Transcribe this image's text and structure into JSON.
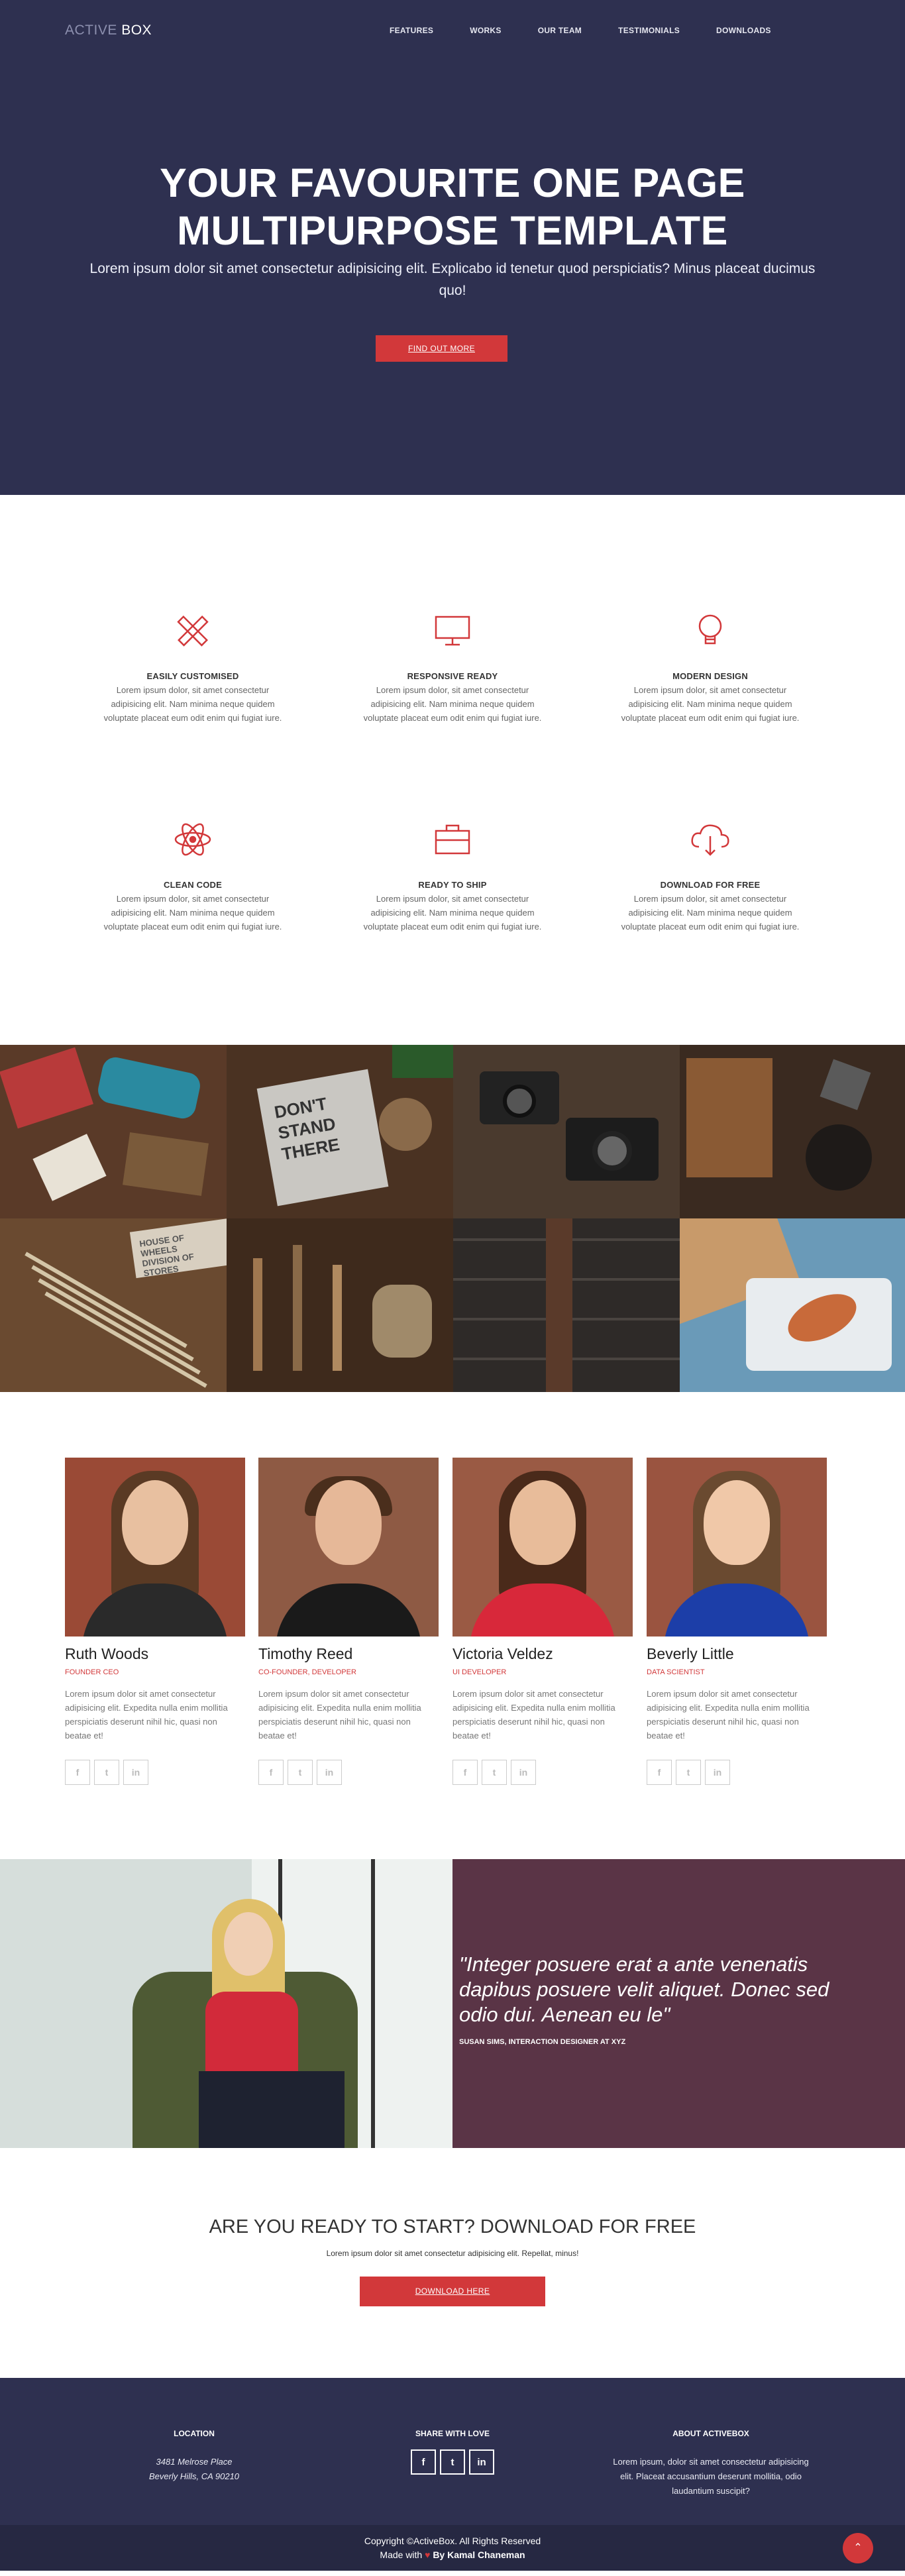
{
  "brand": {
    "part1": "ACTIVE",
    "part2": "BOX"
  },
  "nav": [
    "FEATURES",
    "WORKS",
    "OUR TEAM",
    "TESTIMONIALS",
    "DOWNLOADS"
  ],
  "hero": {
    "title_line1": "YOUR FAVOURITE ONE PAGE",
    "title_line2": "MULTIPURPOSE TEMPLATE",
    "subtitle": "Lorem ipsum dolor sit amet consectetur adipisicing elit. Explicabo id tenetur quod perspiciatis? Minus placeat ducimus quo!",
    "button": "FIND OUT MORE"
  },
  "features": [
    {
      "icon": "pencil-ruler-icon",
      "title": "EASILY CUSTOMISED",
      "text": "Lorem ipsum dolor, sit amet consectetur adipisicing elit. Nam minima neque quidem voluptate placeat eum odit enim qui fugiat iure."
    },
    {
      "icon": "monitor-icon",
      "title": "RESPONSIVE READY",
      "text": "Lorem ipsum dolor, sit amet consectetur adipisicing elit. Nam minima neque quidem voluptate placeat eum odit enim qui fugiat iure."
    },
    {
      "icon": "lightbulb-icon",
      "title": "MODERN DESIGN",
      "text": "Lorem ipsum dolor, sit amet consectetur adipisicing elit. Nam minima neque quidem voluptate placeat eum odit enim qui fugiat iure."
    },
    {
      "icon": "atom-icon",
      "title": "CLEAN CODE",
      "text": "Lorem ipsum dolor, sit amet consectetur adipisicing elit. Nam minima neque quidem voluptate placeat eum odit enim qui fugiat iure."
    },
    {
      "icon": "briefcase-icon",
      "title": "READY TO SHIP",
      "text": "Lorem ipsum dolor, sit amet consectetur adipisicing elit. Nam minima neque quidem voluptate placeat eum odit enim qui fugiat iure."
    },
    {
      "icon": "cloud-download-icon",
      "title": "DOWNLOAD FOR FREE",
      "text": "Lorem ipsum dolor, sit amet consectetur adipisicing elit. Nam minima neque quidem voluptate placeat eum odit enim qui fugiat iure."
    }
  ],
  "gallery_text": {
    "tile2_line1": "DON'T",
    "tile2_line2": "STAND",
    "tile2_line3": "THERE",
    "tile5_line1": "HOUSE OF WHEELS",
    "tile5_line2": "DIVISION OF STORES"
  },
  "team": [
    {
      "name": "Ruth Woods",
      "role": "FOUNDER CEO",
      "text": "Lorem ipsum dolor sit amet consectetur adipisicing elit. Expedita nulla enim mollitia perspiciatis deserunt nihil hic, quasi non beatae et!"
    },
    {
      "name": "Timothy Reed",
      "role": "CO-FOUNDER, DEVELOPER",
      "text": "Lorem ipsum dolor sit amet consectetur adipisicing elit. Expedita nulla enim mollitia perspiciatis deserunt nihil hic, quasi non beatae et!"
    },
    {
      "name": "Victoria Veldez",
      "role": "UI DEVELOPER",
      "text": "Lorem ipsum dolor sit amet consectetur adipisicing elit. Expedita nulla enim mollitia perspiciatis deserunt nihil hic, quasi non beatae et!"
    },
    {
      "name": "Beverly Little",
      "role": "DATA SCIENTIST",
      "text": "Lorem ipsum dolor sit amet consectetur adipisicing elit. Expedita nulla enim mollitia perspiciatis deserunt nihil hic, quasi non beatae et!"
    }
  ],
  "testimonial": {
    "quote": "\"Integer posuere erat a ante venenatis dapibus posuere velit aliquet. Donec sed odio dui. Aenean eu le\"",
    "author": "SUSAN SIMS, INTERACTION DESIGNER AT XYZ"
  },
  "cta": {
    "title": "ARE YOU READY TO START? DOWNLOAD FOR FREE",
    "text": "Lorem ipsum dolor sit amet consectetur adipisicing elit. Repellat, minus!",
    "button": "DOWNLOAD HERE"
  },
  "footer": {
    "location_title": "LOCATION",
    "address_line1": "3481 Melrose Place",
    "address_line2": "Beverly Hills, CA 90210",
    "share_title": "SHARE WITH LOVE",
    "about_title": "ABOUT ACTIVEBOX",
    "about_text": "Lorem ipsum, dolor sit amet consectetur adipisicing elit. Placeat accusantium deserunt mollitia, odio laudantium suscipit?",
    "copyright": "Copyright ©ActiveBox. All Rights Reserved",
    "made_with": "Made with",
    "made_by": "By Kamal Chaneman"
  },
  "colors": {
    "navy": "#2e3050",
    "accent": "#d2383a",
    "plum": "#5a3446"
  }
}
